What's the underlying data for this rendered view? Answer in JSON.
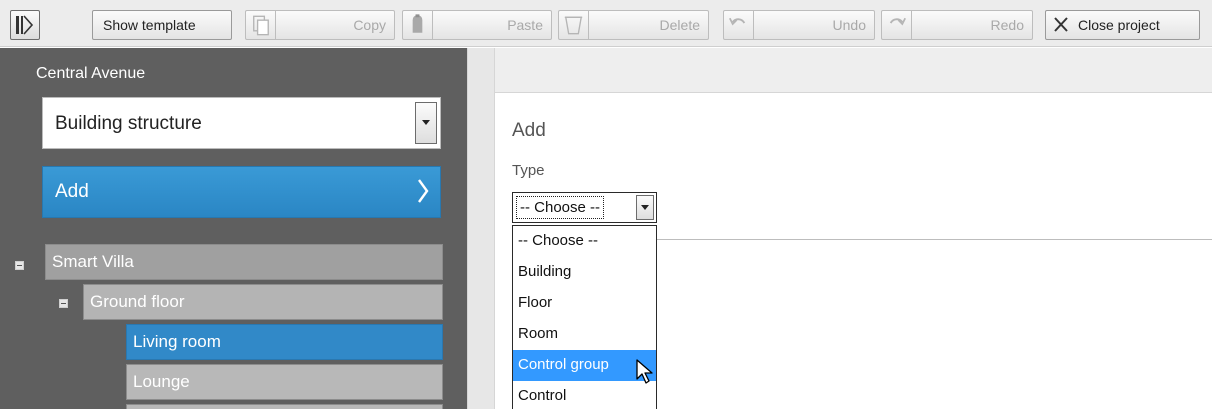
{
  "toolbar": {
    "show_template": "Show template",
    "copy": "Copy",
    "paste": "Paste",
    "delete": "Delete",
    "undo": "Undo",
    "redo": "Redo",
    "close_project": "Close project"
  },
  "sidebar": {
    "project_name": "Central Avenue",
    "view_select_value": "Building structure",
    "add_label": "Add",
    "tree": [
      {
        "label": "Smart Villa",
        "level": 0,
        "expanded": true
      },
      {
        "label": "Ground floor",
        "level": 1,
        "expanded": true
      },
      {
        "label": "Living room",
        "level": 2,
        "selected": true
      },
      {
        "label": "Lounge",
        "level": 2
      }
    ]
  },
  "form": {
    "title": "Add",
    "type_label": "Type",
    "type_value": "-- Choose --",
    "options": [
      "-- Choose --",
      "Building",
      "Floor",
      "Room",
      "Control group",
      "Control"
    ],
    "highlighted_option": "Control group"
  },
  "colors": {
    "accent": "#2a86c4",
    "sidebar_bg": "#5f5f5f",
    "tree_level0": "#a0a0a0",
    "tree_level1": "#b4b4b4",
    "tree_selected": "#3189c8",
    "tree_item": "#b8b8b8",
    "dropdown_highlight": "#3399ff"
  }
}
